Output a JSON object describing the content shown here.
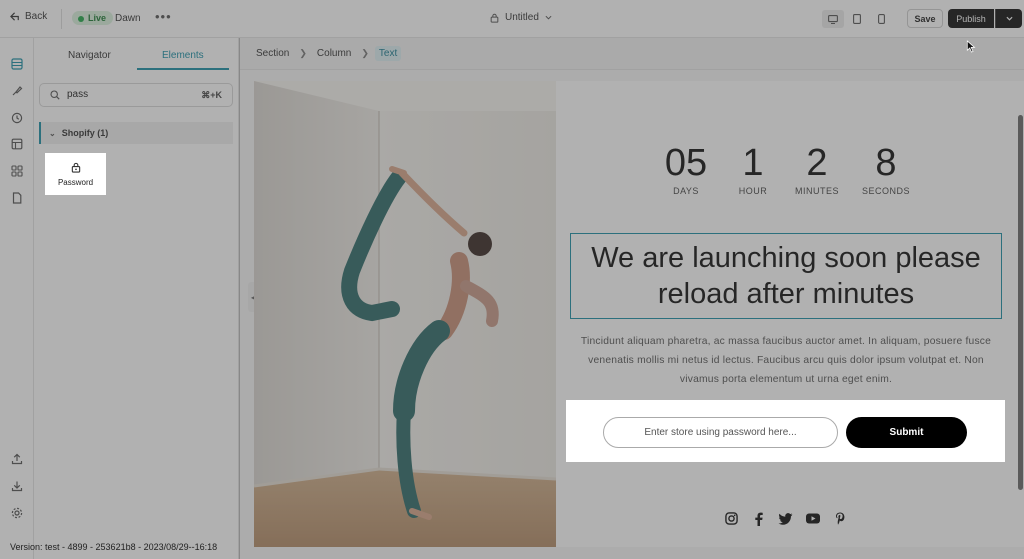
{
  "topbar": {
    "back_label": "Back",
    "status_label": "Live",
    "theme_name": "Dawn",
    "page_title": "Untitled",
    "save_label": "Save",
    "publish_label": "Publish"
  },
  "panel": {
    "tabs": [
      {
        "label": "Navigator"
      },
      {
        "label": "Elements"
      }
    ],
    "search": {
      "value": "pass",
      "shortcut": "⌘+K"
    },
    "group": {
      "label": "Shopify (1)"
    },
    "element": {
      "label": "Password"
    }
  },
  "breadcrumb": [
    "Section",
    "Column",
    "Text"
  ],
  "countdown": [
    {
      "value": "05",
      "label": "DAYS"
    },
    {
      "value": "1",
      "label": "HOUR"
    },
    {
      "value": "2",
      "label": "MINUTES"
    },
    {
      "value": "8",
      "label": "SECONDS"
    }
  ],
  "headline": "We are launching soon please reload after minutes",
  "body_text": "Tincidunt aliquam pharetra, ac massa faucibus auctor amet. In aliquam, posuere fusce venenatis mollis mi netus id lectus. Faucibus arcu quis dolor ipsum volutpat et. Non vivamus porta elementum ut urna eget enim.",
  "form": {
    "placeholder": "Enter store using password here...",
    "submit_label": "Submit"
  },
  "socials": [
    "instagram-icon",
    "facebook-icon",
    "twitter-icon",
    "youtube-icon",
    "pinterest-icon"
  ],
  "version": "Version: test - 4899 - 253621b8 - 2023/08/29--16:18",
  "colors": {
    "accent": "#1a8fa6",
    "live": "#23a94a",
    "primary": "#000000"
  }
}
